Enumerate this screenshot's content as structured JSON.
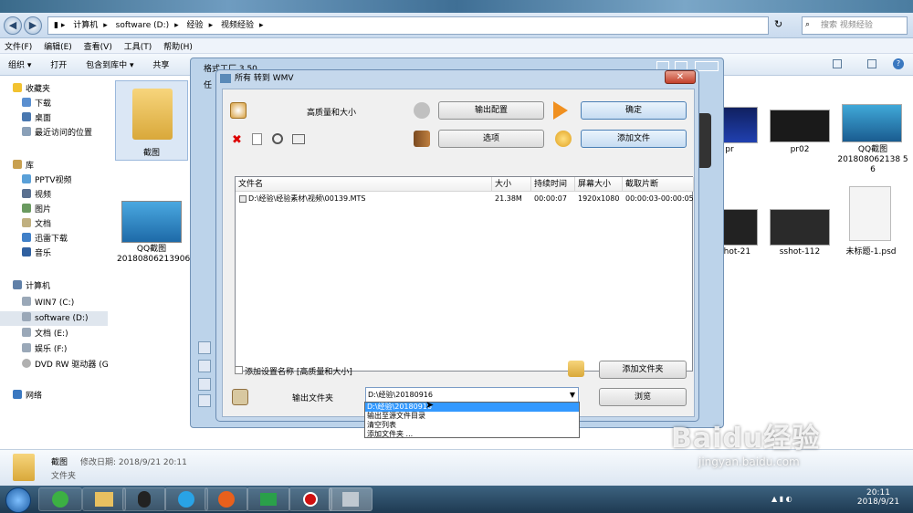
{
  "address": {
    "crumbs": [
      "计算机",
      "software (D:)",
      "经验",
      "视频经验"
    ],
    "search_placeholder": "搜索 视频经验"
  },
  "menu": [
    "文件(F)",
    "编辑(E)",
    "查看(V)",
    "工具(T)",
    "帮助(H)"
  ],
  "toolbar": [
    "组织 ▾",
    "打开",
    "包含到库中 ▾",
    "共享"
  ],
  "sidebar": {
    "favorites": "收藏夹",
    "fav_items": [
      "下载",
      "桌面",
      "最近访问的位置"
    ],
    "library": "库",
    "lib_items": [
      "PPTV视频",
      "视频",
      "图片",
      "文档",
      "迅雷下载",
      "音乐"
    ],
    "computer": "计算机",
    "drives": [
      "WIN7 (C:)",
      "software (D:)",
      "文档 (E:)",
      "娱乐 (F:)",
      "DVD RW 驱动器 (G"
    ],
    "network": "网络"
  },
  "files": {
    "folder_label": "截图",
    "qq1": [
      "QQ截图",
      "20180806213906"
    ],
    "right": [
      "pr",
      "pr02",
      "QQ截图",
      "201808062138 5",
      "6"
    ],
    "row2": [
      "shot-21",
      "sshot-112",
      "未标题-1.psd"
    ]
  },
  "status": {
    "name": "截图",
    "meta": "修改日期: 2018/9/21 20:11",
    "type": "文件夹"
  },
  "bgwindow": {
    "title": "格式工厂 3.50",
    "menu_hint": "任"
  },
  "dialog": {
    "title": "所有 转到 WMV",
    "preset": "高质量和大小",
    "output_config": "输出配置",
    "ok": "确定",
    "options": "选项",
    "add_file": "添加文件",
    "columns": [
      "文件名",
      "大小",
      "持续时间",
      "屏幕大小",
      "截取片断"
    ],
    "row": {
      "name": "D:\\经验\\经验素材\\视频\\00139.MTS",
      "size": "21.38M",
      "duration": "00:00:07",
      "screen": "1920x1080",
      "clip": "00:00:03-00:00:05"
    },
    "add_setting_name": "添加设置名称 [高质量和大小]",
    "add_folder": "添加文件夹",
    "output_folder": "输出文件夹",
    "combo_value": "D:\\经验\\20180916",
    "browse": "浏览",
    "dropdown": [
      "D:\\经验\\20180916",
      "输出至源文件目录",
      "清空列表",
      "添加文件夹 ..."
    ]
  },
  "taskbar": {
    "time": "20:11",
    "date": "2018/9/21"
  },
  "watermark": {
    "brand": "Baidu经验",
    "url": "jingyan.baidu.com"
  }
}
